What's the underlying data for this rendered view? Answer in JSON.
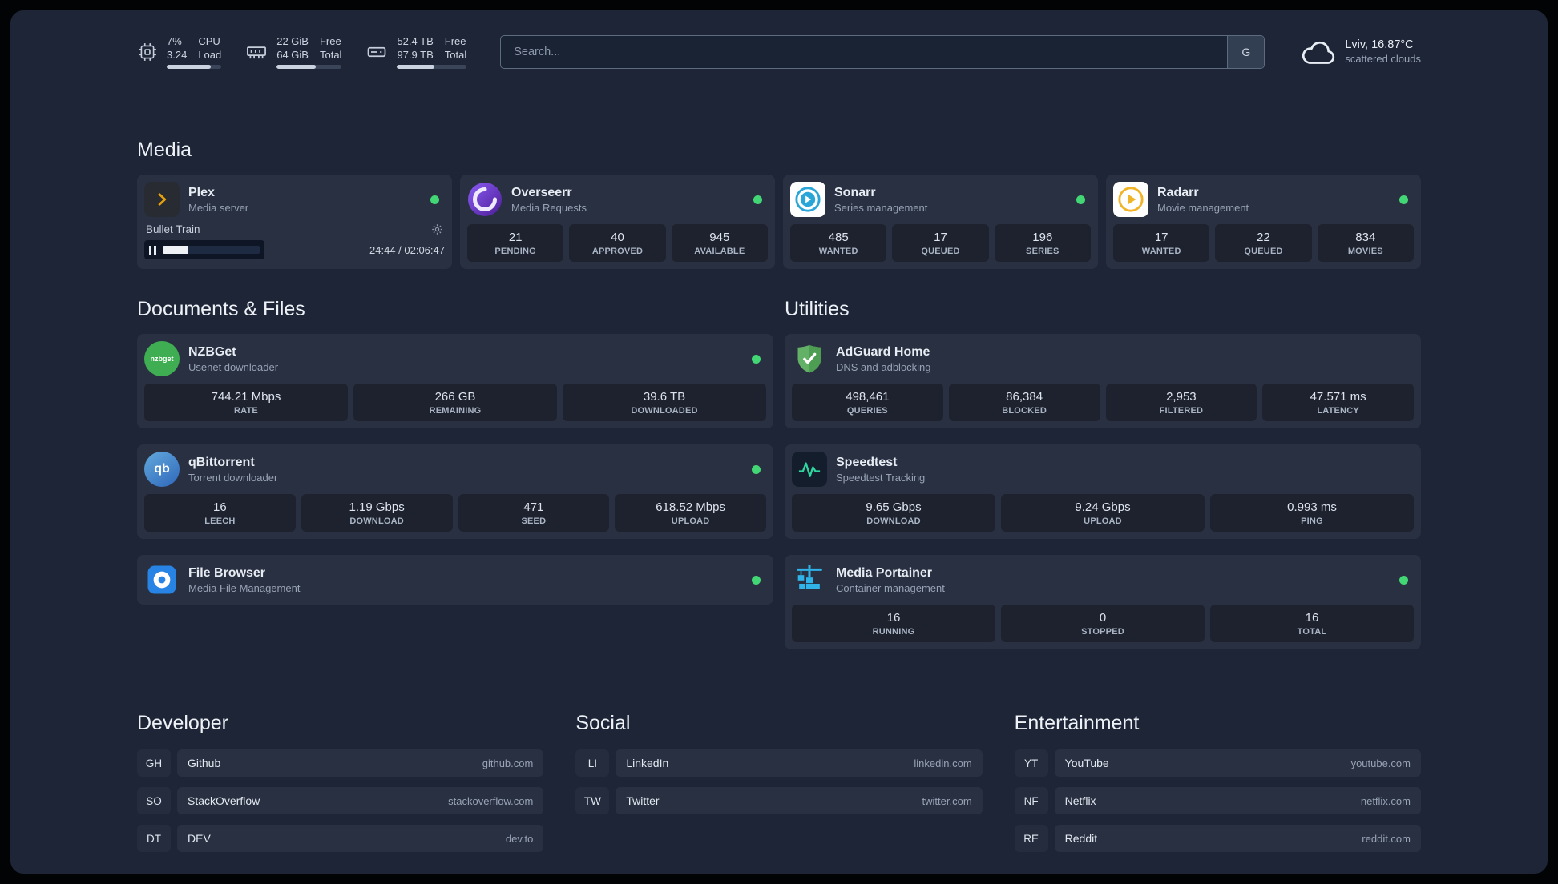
{
  "topbar": {
    "resources": [
      {
        "value_a": "7%",
        "value_b": "3.24",
        "label_a": "CPU",
        "label_b": "Load",
        "percent": 80
      },
      {
        "value_a": "22 GiB",
        "value_b": "64 GiB",
        "label_a": "Free",
        "label_b": "Total",
        "percent": 60
      },
      {
        "value_a": "52.4 TB",
        "value_b": "97.9 TB",
        "label_a": "Free",
        "label_b": "Total",
        "percent": 54
      }
    ],
    "search": {
      "placeholder": "Search...",
      "provider_label": "G"
    },
    "weather": {
      "location": "Lviv, 16.87°C",
      "condition": "scattered clouds"
    }
  },
  "sections": {
    "media": {
      "title": "Media",
      "cards": [
        {
          "name": "Plex",
          "subtitle": "Media server",
          "player": {
            "track": "Bullet Train",
            "time": "24:44 / 02:06:47",
            "progress_percent": 26
          }
        },
        {
          "name": "Overseerr",
          "subtitle": "Media Requests",
          "stats": [
            {
              "value": "21",
              "label": "PENDING"
            },
            {
              "value": "40",
              "label": "APPROVED"
            },
            {
              "value": "945",
              "label": "AVAILABLE"
            }
          ]
        },
        {
          "name": "Sonarr",
          "subtitle": "Series management",
          "stats": [
            {
              "value": "485",
              "label": "WANTED"
            },
            {
              "value": "17",
              "label": "QUEUED"
            },
            {
              "value": "196",
              "label": "SERIES"
            }
          ]
        },
        {
          "name": "Radarr",
          "subtitle": "Movie management",
          "stats": [
            {
              "value": "17",
              "label": "WANTED"
            },
            {
              "value": "22",
              "label": "QUEUED"
            },
            {
              "value": "834",
              "label": "MOVIES"
            }
          ]
        }
      ]
    },
    "documents": {
      "title": "Documents & Files",
      "cards": [
        {
          "name": "NZBGet",
          "subtitle": "Usenet downloader",
          "icon_text": "nzbget",
          "stats": [
            {
              "value": "744.21 Mbps",
              "label": "RATE"
            },
            {
              "value": "266 GB",
              "label": "REMAINING"
            },
            {
              "value": "39.6 TB",
              "label": "DOWNLOADED"
            }
          ]
        },
        {
          "name": "qBittorrent",
          "subtitle": "Torrent downloader",
          "icon_text": "qb",
          "stats": [
            {
              "value": "16",
              "label": "LEECH"
            },
            {
              "value": "1.19 Gbps",
              "label": "DOWNLOAD"
            },
            {
              "value": "471",
              "label": "SEED"
            },
            {
              "value": "618.52 Mbps",
              "label": "UPLOAD"
            }
          ]
        },
        {
          "name": "File Browser",
          "subtitle": "Media File Management"
        }
      ]
    },
    "utilities": {
      "title": "Utilities",
      "cards": [
        {
          "name": "AdGuard Home",
          "subtitle": "DNS and adblocking",
          "stats": [
            {
              "value": "498,461",
              "label": "QUERIES"
            },
            {
              "value": "86,384",
              "label": "BLOCKED"
            },
            {
              "value": "2,953",
              "label": "FILTERED"
            },
            {
              "value": "47.571 ms",
              "label": "LATENCY"
            }
          ]
        },
        {
          "name": "Speedtest",
          "subtitle": "Speedtest Tracking",
          "stats": [
            {
              "value": "9.65 Gbps",
              "label": "DOWNLOAD"
            },
            {
              "value": "9.24 Gbps",
              "label": "UPLOAD"
            },
            {
              "value": "0.993 ms",
              "label": "PING"
            }
          ]
        },
        {
          "name": "Media Portainer",
          "subtitle": "Container management",
          "stats": [
            {
              "value": "16",
              "label": "RUNNING"
            },
            {
              "value": "0",
              "label": "STOPPED"
            },
            {
              "value": "16",
              "label": "TOTAL"
            }
          ]
        }
      ]
    },
    "bookmarks": [
      {
        "title": "Developer",
        "items": [
          {
            "abbr": "GH",
            "name": "Github",
            "url": "github.com"
          },
          {
            "abbr": "SO",
            "name": "StackOverflow",
            "url": "stackoverflow.com"
          },
          {
            "abbr": "DT",
            "name": "DEV",
            "url": "dev.to"
          }
        ]
      },
      {
        "title": "Social",
        "items": [
          {
            "abbr": "LI",
            "name": "LinkedIn",
            "url": "linkedin.com"
          },
          {
            "abbr": "TW",
            "name": "Twitter",
            "url": "twitter.com"
          }
        ]
      },
      {
        "title": "Entertainment",
        "items": [
          {
            "abbr": "YT",
            "name": "YouTube",
            "url": "youtube.com"
          },
          {
            "abbr": "NF",
            "name": "Netflix",
            "url": "netflix.com"
          },
          {
            "abbr": "RE",
            "name": "Reddit",
            "url": "reddit.com"
          }
        ]
      }
    ]
  },
  "colors": {
    "accent_green": "#43d675",
    "panel_bg": "#1d2536",
    "plex_amber": "#e5a00d"
  }
}
